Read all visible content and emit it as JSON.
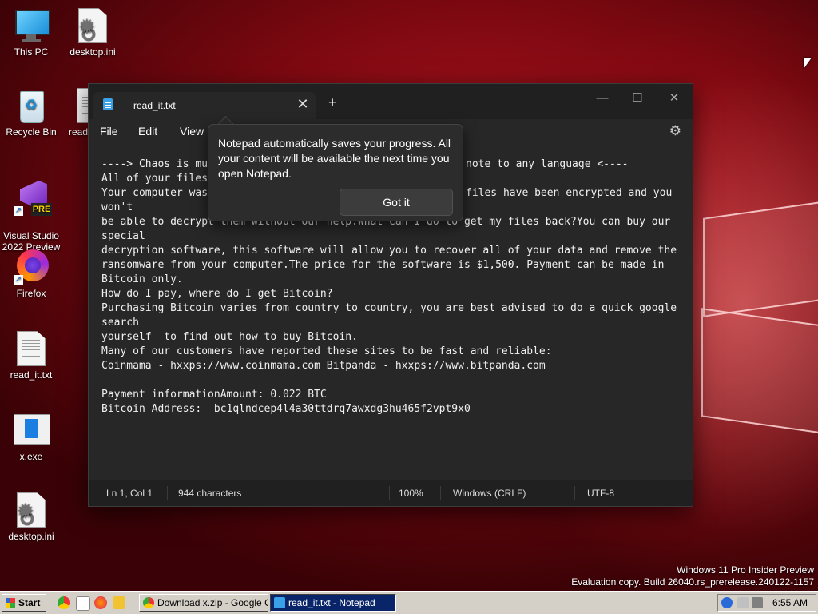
{
  "desktop": {
    "icons": [
      {
        "label": "This PC"
      },
      {
        "label": "desktop.ini"
      },
      {
        "label": "Recycle Bin"
      },
      {
        "label": "Visual Studio\n2022 Preview"
      },
      {
        "label": "Firefox"
      },
      {
        "label": "read_it.txt"
      },
      {
        "label": "x.exe"
      },
      {
        "label": "desktop.ini"
      },
      {
        "label": "read"
      }
    ],
    "vs_badge": "PRE"
  },
  "notepad": {
    "tab_title": "read_it.txt",
    "tab_close": "✕",
    "new_tab": "+",
    "window_buttons": {
      "minimize": "—",
      "maximize": "☐",
      "close": "✕"
    },
    "menu": {
      "file": "File",
      "edit": "Edit",
      "view": "View"
    },
    "settings_icon": "⚙",
    "content_lines": [
      "----> Chaos is mu",
      "All of your files",
      "Your computer was",
      "won't",
      "be able to decrypt them without our help.What can I do to get my files back?You can buy our",
      "special",
      "decryption software, this software will allow you to recover all of your data and remove the",
      "ransomware from your computer.The price for the software is $1,500. Payment can be made in",
      "Bitcoin only.",
      "How do I pay, where do I get Bitcoin?",
      "Purchasing Bitcoin varies from country to country, you are best advised to do a quick google",
      "search",
      "yourself  to find out how to buy Bitcoin.",
      "Many of our customers have reported these sites to be fast and reliable:",
      "Coinmama - hxxps://www.coinmama.com Bitpanda - hxxps://www.bitpanda.com",
      "",
      "Payment informationAmount: 0.022 BTC",
      "Bitcoin Address:  bc1qlndcep4l4a30ttdrq7awxdg3hu465f2vpt9x0"
    ],
    "hidden_line_ends": [
      {
        "line": 0,
        "text": "note to any language <----"
      },
      {
        "line": 2,
        "text": "files have been encrypted and you"
      }
    ],
    "status": {
      "position": "Ln 1, Col 1",
      "characters": "944 characters",
      "zoom": "100%",
      "line_ending": "Windows (CRLF)",
      "encoding": "UTF-8"
    }
  },
  "popup": {
    "message": "Notepad automatically saves your progress. All your content will be available the next time you open Notepad.",
    "button": "Got it"
  },
  "watermark": {
    "line1": "Windows 11 Pro Insider Preview",
    "line2": "Evaluation copy. Build 26040.rs_prerelease.240122-1157"
  },
  "taskbar": {
    "start": "Start",
    "buttons": [
      {
        "label": "Download x.zip - Google C..."
      },
      {
        "label": "read_it.txt - Notepad"
      }
    ],
    "clock": "6:55 AM"
  }
}
